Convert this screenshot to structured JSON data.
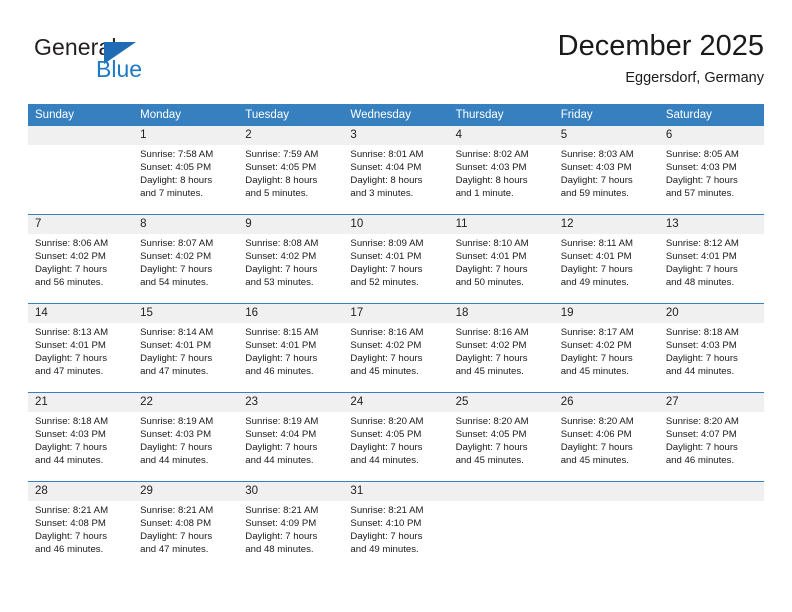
{
  "brand": {
    "name_top": "General",
    "name_bottom": "Blue",
    "triangle_color": "#1f6cb4",
    "blue_color": "#1f7ac4"
  },
  "header": {
    "title": "December 2025",
    "subtitle": "Eggersdorf, Germany"
  },
  "theme": {
    "header_bar": "#3680c0",
    "day_band": "#f0f0f0",
    "text": "#1a1a1a"
  },
  "weekdays": [
    "Sunday",
    "Monday",
    "Tuesday",
    "Wednesday",
    "Thursday",
    "Friday",
    "Saturday"
  ],
  "labels": {
    "sunrise_prefix": "Sunrise:",
    "sunset_prefix": "Sunset:",
    "daylight_prefix": "Daylight:"
  },
  "weeks": [
    [
      {
        "day": "",
        "blank": true
      },
      {
        "day": "1",
        "sunrise": "Sunrise: 7:58 AM",
        "sunset": "Sunset: 4:05 PM",
        "daylight1": "Daylight: 8 hours",
        "daylight2": "and 7 minutes."
      },
      {
        "day": "2",
        "sunrise": "Sunrise: 7:59 AM",
        "sunset": "Sunset: 4:05 PM",
        "daylight1": "Daylight: 8 hours",
        "daylight2": "and 5 minutes."
      },
      {
        "day": "3",
        "sunrise": "Sunrise: 8:01 AM",
        "sunset": "Sunset: 4:04 PM",
        "daylight1": "Daylight: 8 hours",
        "daylight2": "and 3 minutes."
      },
      {
        "day": "4",
        "sunrise": "Sunrise: 8:02 AM",
        "sunset": "Sunset: 4:03 PM",
        "daylight1": "Daylight: 8 hours",
        "daylight2": "and 1 minute."
      },
      {
        "day": "5",
        "sunrise": "Sunrise: 8:03 AM",
        "sunset": "Sunset: 4:03 PM",
        "daylight1": "Daylight: 7 hours",
        "daylight2": "and 59 minutes."
      },
      {
        "day": "6",
        "sunrise": "Sunrise: 8:05 AM",
        "sunset": "Sunset: 4:03 PM",
        "daylight1": "Daylight: 7 hours",
        "daylight2": "and 57 minutes."
      }
    ],
    [
      {
        "day": "7",
        "sunrise": "Sunrise: 8:06 AM",
        "sunset": "Sunset: 4:02 PM",
        "daylight1": "Daylight: 7 hours",
        "daylight2": "and 56 minutes."
      },
      {
        "day": "8",
        "sunrise": "Sunrise: 8:07 AM",
        "sunset": "Sunset: 4:02 PM",
        "daylight1": "Daylight: 7 hours",
        "daylight2": "and 54 minutes."
      },
      {
        "day": "9",
        "sunrise": "Sunrise: 8:08 AM",
        "sunset": "Sunset: 4:02 PM",
        "daylight1": "Daylight: 7 hours",
        "daylight2": "and 53 minutes."
      },
      {
        "day": "10",
        "sunrise": "Sunrise: 8:09 AM",
        "sunset": "Sunset: 4:01 PM",
        "daylight1": "Daylight: 7 hours",
        "daylight2": "and 52 minutes."
      },
      {
        "day": "11",
        "sunrise": "Sunrise: 8:10 AM",
        "sunset": "Sunset: 4:01 PM",
        "daylight1": "Daylight: 7 hours",
        "daylight2": "and 50 minutes."
      },
      {
        "day": "12",
        "sunrise": "Sunrise: 8:11 AM",
        "sunset": "Sunset: 4:01 PM",
        "daylight1": "Daylight: 7 hours",
        "daylight2": "and 49 minutes."
      },
      {
        "day": "13",
        "sunrise": "Sunrise: 8:12 AM",
        "sunset": "Sunset: 4:01 PM",
        "daylight1": "Daylight: 7 hours",
        "daylight2": "and 48 minutes."
      }
    ],
    [
      {
        "day": "14",
        "sunrise": "Sunrise: 8:13 AM",
        "sunset": "Sunset: 4:01 PM",
        "daylight1": "Daylight: 7 hours",
        "daylight2": "and 47 minutes."
      },
      {
        "day": "15",
        "sunrise": "Sunrise: 8:14 AM",
        "sunset": "Sunset: 4:01 PM",
        "daylight1": "Daylight: 7 hours",
        "daylight2": "and 47 minutes."
      },
      {
        "day": "16",
        "sunrise": "Sunrise: 8:15 AM",
        "sunset": "Sunset: 4:01 PM",
        "daylight1": "Daylight: 7 hours",
        "daylight2": "and 46 minutes."
      },
      {
        "day": "17",
        "sunrise": "Sunrise: 8:16 AM",
        "sunset": "Sunset: 4:02 PM",
        "daylight1": "Daylight: 7 hours",
        "daylight2": "and 45 minutes."
      },
      {
        "day": "18",
        "sunrise": "Sunrise: 8:16 AM",
        "sunset": "Sunset: 4:02 PM",
        "daylight1": "Daylight: 7 hours",
        "daylight2": "and 45 minutes."
      },
      {
        "day": "19",
        "sunrise": "Sunrise: 8:17 AM",
        "sunset": "Sunset: 4:02 PM",
        "daylight1": "Daylight: 7 hours",
        "daylight2": "and 45 minutes."
      },
      {
        "day": "20",
        "sunrise": "Sunrise: 8:18 AM",
        "sunset": "Sunset: 4:03 PM",
        "daylight1": "Daylight: 7 hours",
        "daylight2": "and 44 minutes."
      }
    ],
    [
      {
        "day": "21",
        "sunrise": "Sunrise: 8:18 AM",
        "sunset": "Sunset: 4:03 PM",
        "daylight1": "Daylight: 7 hours",
        "daylight2": "and 44 minutes."
      },
      {
        "day": "22",
        "sunrise": "Sunrise: 8:19 AM",
        "sunset": "Sunset: 4:03 PM",
        "daylight1": "Daylight: 7 hours",
        "daylight2": "and 44 minutes."
      },
      {
        "day": "23",
        "sunrise": "Sunrise: 8:19 AM",
        "sunset": "Sunset: 4:04 PM",
        "daylight1": "Daylight: 7 hours",
        "daylight2": "and 44 minutes."
      },
      {
        "day": "24",
        "sunrise": "Sunrise: 8:20 AM",
        "sunset": "Sunset: 4:05 PM",
        "daylight1": "Daylight: 7 hours",
        "daylight2": "and 44 minutes."
      },
      {
        "day": "25",
        "sunrise": "Sunrise: 8:20 AM",
        "sunset": "Sunset: 4:05 PM",
        "daylight1": "Daylight: 7 hours",
        "daylight2": "and 45 minutes."
      },
      {
        "day": "26",
        "sunrise": "Sunrise: 8:20 AM",
        "sunset": "Sunset: 4:06 PM",
        "daylight1": "Daylight: 7 hours",
        "daylight2": "and 45 minutes."
      },
      {
        "day": "27",
        "sunrise": "Sunrise: 8:20 AM",
        "sunset": "Sunset: 4:07 PM",
        "daylight1": "Daylight: 7 hours",
        "daylight2": "and 46 minutes."
      }
    ],
    [
      {
        "day": "28",
        "sunrise": "Sunrise: 8:21 AM",
        "sunset": "Sunset: 4:08 PM",
        "daylight1": "Daylight: 7 hours",
        "daylight2": "and 46 minutes."
      },
      {
        "day": "29",
        "sunrise": "Sunrise: 8:21 AM",
        "sunset": "Sunset: 4:08 PM",
        "daylight1": "Daylight: 7 hours",
        "daylight2": "and 47 minutes."
      },
      {
        "day": "30",
        "sunrise": "Sunrise: 8:21 AM",
        "sunset": "Sunset: 4:09 PM",
        "daylight1": "Daylight: 7 hours",
        "daylight2": "and 48 minutes."
      },
      {
        "day": "31",
        "sunrise": "Sunrise: 8:21 AM",
        "sunset": "Sunset: 4:10 PM",
        "daylight1": "Daylight: 7 hours",
        "daylight2": "and 49 minutes."
      },
      {
        "day": "",
        "blank": true
      },
      {
        "day": "",
        "blank": true
      },
      {
        "day": "",
        "blank": true
      }
    ]
  ]
}
